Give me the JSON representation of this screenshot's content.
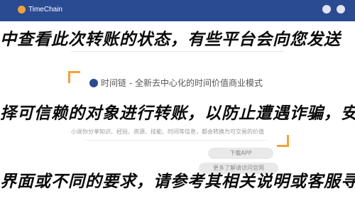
{
  "header": {
    "logo_text": "TimeChain",
    "accent": "#f0a23a",
    "bar_color": "#2a4b92"
  },
  "banner": {
    "title": "时间链 - 全新去中心化的时间价值商业模式",
    "subtitle": "小说你分享知识、经验、资源、技能、时间等信息，都会转换为可交易的价值",
    "download_label": "下载APP",
    "more_label": "更多了解请访问官网"
  },
  "overlay": {
    "line1": "中查看此次转账的状态，有些平台会向您发送",
    "line2": "择可信赖的对象进行转账，以防止遭遇诈骗，安",
    "line3": "界面或不同的要求，请参考其相关说明或客服寻"
  }
}
